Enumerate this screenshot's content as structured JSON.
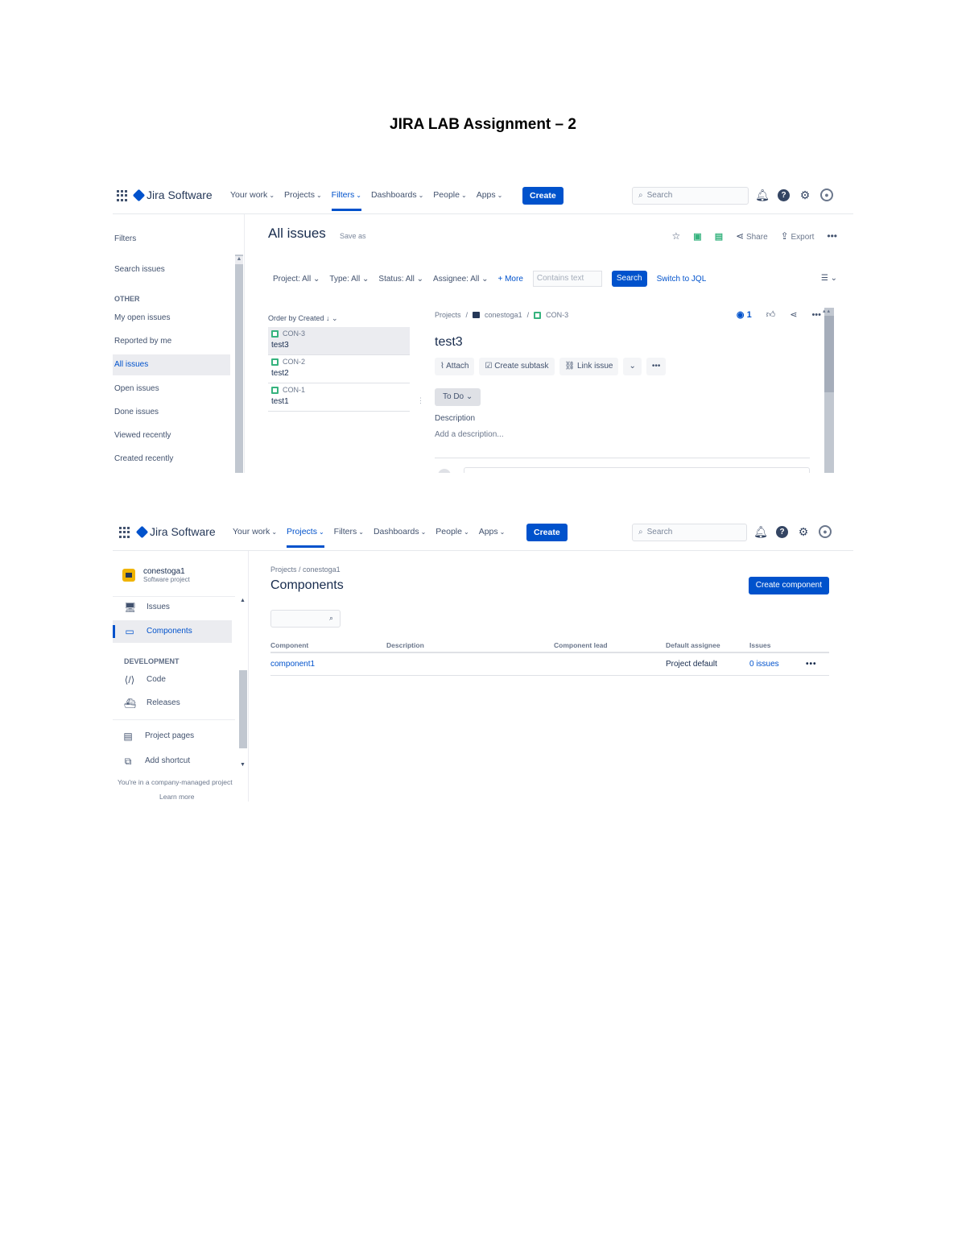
{
  "document": {
    "title": "JIRA LAB Assignment – 2"
  },
  "nav": {
    "app_name": "Jira Software",
    "your_work": "Your work",
    "projects": "Projects",
    "filters": "Filters",
    "dashboards": "Dashboards",
    "people": "People",
    "apps": "Apps",
    "create": "Create",
    "search_placeholder": "Search"
  },
  "screen1": {
    "sidebar": {
      "heading": "Filters",
      "search_issues": "Search issues",
      "section_other": "OTHER",
      "items": [
        "My open issues",
        "Reported by me",
        "All issues",
        "Open issues",
        "Done issues",
        "Viewed recently",
        "Created recently"
      ],
      "selected_item": "All issues"
    },
    "title": "All issues",
    "save_as": "Save as",
    "share": "Share",
    "export": "Export",
    "filters": {
      "project": "Project: All",
      "type": "Type: All",
      "status": "Status: All",
      "assignee": "Assignee: All",
      "more": "+ More",
      "contains_placeholder": "Contains text",
      "search": "Search",
      "switch_jql": "Switch to JQL"
    },
    "order_by": "Order by Created",
    "issues": [
      {
        "key": "CON-3",
        "summary": "test3"
      },
      {
        "key": "CON-2",
        "summary": "test2"
      },
      {
        "key": "CON-1",
        "summary": "test1"
      }
    ],
    "detail": {
      "breadcrumb_projects": "Projects",
      "breadcrumb_project": "conestoga1",
      "breadcrumb_issue": "CON-3",
      "watchers": "1",
      "title": "test3",
      "attach": "Attach",
      "create_subtask": "Create subtask",
      "link_issue": "Link issue",
      "status": "To Do",
      "description_label": "Description",
      "description_placeholder": "Add a description..."
    }
  },
  "screen2": {
    "project_name": "conestoga1",
    "project_type": "Software project",
    "sidebar_items": {
      "issues": "Issues",
      "components": "Components",
      "section_development": "DEVELOPMENT",
      "code": "Code",
      "releases": "Releases",
      "project_pages": "Project pages",
      "add_shortcut": "Add shortcut"
    },
    "managed_note": "You're in a company-managed project",
    "learn_more": "Learn more",
    "breadcrumb_projects": "Projects",
    "breadcrumb_project": "conestoga1",
    "title": "Components",
    "create_component": "Create component",
    "table": {
      "headers": [
        "Component",
        "Description",
        "Component lead",
        "Default assignee",
        "Issues"
      ],
      "rows": [
        {
          "component": "component1",
          "description": "",
          "lead": "",
          "assignee": "Project default",
          "issues": "0 issues"
        }
      ]
    }
  },
  "icons": {
    "star": "star-icon",
    "share": "share-icon",
    "export": "export-icon",
    "notifications": "notification-icon",
    "help": "help-icon",
    "settings": "gear-icon",
    "profile": "avatar-icon"
  },
  "colors": {
    "brand": "#0052cc",
    "story": "#36b37e",
    "project_avatar": "#f0b400"
  }
}
